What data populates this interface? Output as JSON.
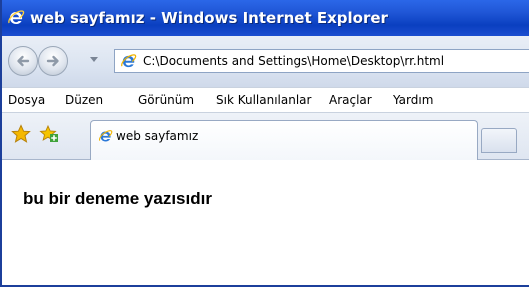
{
  "window": {
    "title": "web sayfamız - Windows Internet Explorer"
  },
  "address_bar": {
    "url": "C:\\Documents and Settings\\Home\\Desktop\\rr.html"
  },
  "menu": {
    "items": [
      "Dosya",
      "Düzen",
      "Görünüm",
      "Sık Kullanılanlar",
      "Araçlar",
      "Yardım"
    ]
  },
  "tabs": [
    {
      "label": "web sayfamız"
    }
  ],
  "page": {
    "heading": "bu bir deneme yazısıdır"
  },
  "colors": {
    "titlebar": "#1f56d6",
    "ie_icon": "#2a78d8",
    "star": "#f5b800",
    "add_favorite": "#3fa23a"
  },
  "icons": [
    "ie-logo-icon",
    "back-arrow-icon",
    "forward-arrow-icon",
    "chevron-down-icon",
    "favorites-star-icon",
    "add-favorite-icon"
  ]
}
